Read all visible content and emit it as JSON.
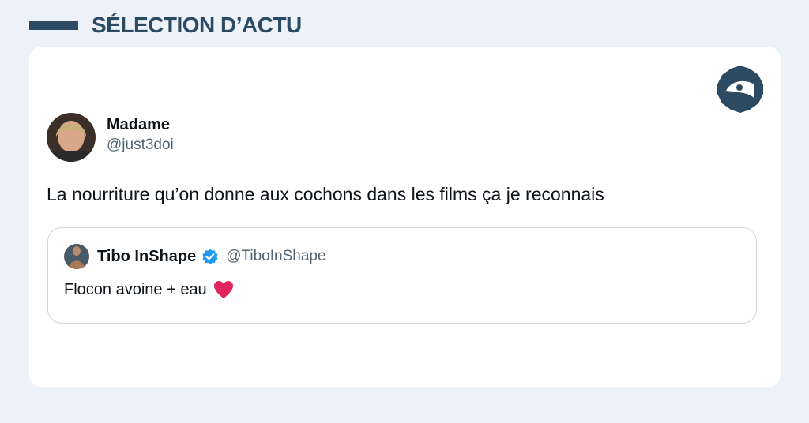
{
  "header": {
    "title": "SÉLECTION D’ACTU"
  },
  "brand": {
    "icon": "fish-logo-icon",
    "color": "#2d4a63"
  },
  "tweet": {
    "display_name": "Madame",
    "handle": "@just3doi",
    "text": "La nourriture qu’on donne aux cochons dans les films ça je reconnais"
  },
  "quote": {
    "display_name": "Tibo InShape",
    "verified": true,
    "handle": "@TiboInShape",
    "text": "Flocon avoine + eau",
    "emoji": "red-heart-icon"
  },
  "colors": {
    "background": "#edf2f8",
    "accent": "#2d4a63",
    "verified": "#1d9bf0",
    "heart": "#e0245e"
  }
}
